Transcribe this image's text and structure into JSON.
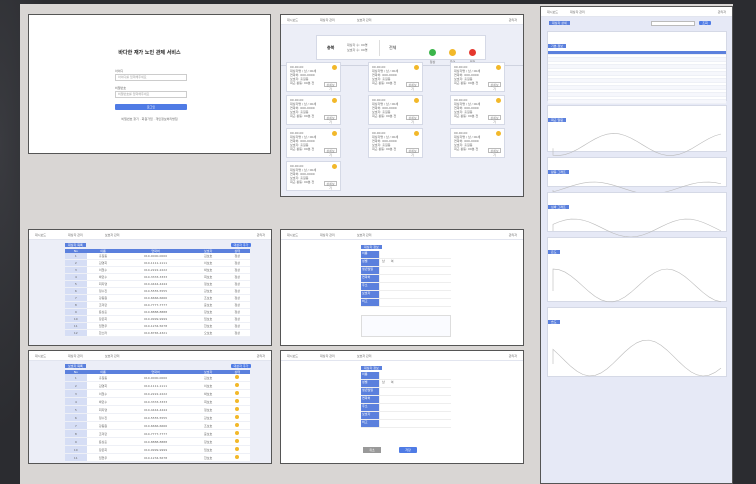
{
  "login": {
    "title": "바다한 재가 노인 관제 서비스",
    "id_label": "아이디",
    "id_placeholder": "아이디를 입력해주세요",
    "pw_label": "비밀번호",
    "pw_placeholder": "비밀번호를 입력해주세요",
    "submit": "로그인",
    "note": "비밀번호 찾기 · 회원가입 · 개인정보처리방침"
  },
  "nav": {
    "tabs": [
      "대시보드",
      "대상자 관리",
      "보호자 관리",
      "사용자 관리"
    ],
    "user": "관리자"
  },
  "dashboard": {
    "location": "충북",
    "count1": "대상자 수: 00명",
    "count2": "보호자 수: 00명",
    "region": "전체",
    "legend": [
      "정상",
      "주의",
      "위험"
    ],
    "card_meta": "00.00.00",
    "card_lines": [
      "대상자명 / 남 / 00세",
      "연락처: 000-0000",
      "보호자: 홍길동",
      "최근 활동: 00분 전"
    ],
    "card_btn": "상세보기"
  },
  "list": {
    "title": "대상자 목록",
    "btn": "대상자 추가",
    "cols": [
      "No",
      "이름",
      "연락처",
      "보호자",
      "상태"
    ],
    "rows": [
      [
        "1",
        "홍길동",
        "010-0000-0000",
        "김보호",
        "정상"
      ],
      [
        "2",
        "김영희",
        "010-1111-1111",
        "이보호",
        "정상"
      ],
      [
        "3",
        "이철수",
        "010-2222-2222",
        "박보호",
        "정상"
      ],
      [
        "4",
        "박민수",
        "010-3333-3333",
        "최보호",
        "정상"
      ],
      [
        "5",
        "최지영",
        "010-4444-4444",
        "정보호",
        "정상"
      ],
      [
        "6",
        "정수진",
        "010-5555-5555",
        "강보호",
        "정상"
      ],
      [
        "7",
        "강동원",
        "010-6666-6666",
        "조보호",
        "정상"
      ],
      [
        "8",
        "조미란",
        "010-7777-7777",
        "윤보호",
        "정상"
      ],
      [
        "9",
        "윤상훈",
        "010-8888-8888",
        "장보호",
        "정상"
      ],
      [
        "10",
        "장은희",
        "010-9999-9999",
        "임보호",
        "정상"
      ],
      [
        "11",
        "임현우",
        "010-1234-5678",
        "한보호",
        "정상"
      ],
      [
        "12",
        "한소라",
        "010-8765-4321",
        "오보호",
        "정상"
      ]
    ]
  },
  "list2": {
    "title": "보호자 목록",
    "rows": 11
  },
  "form": {
    "title": "대상자 정보",
    "labels": [
      "이름",
      "성별",
      "생년월일",
      "연락처",
      "주소",
      "보호자",
      "비고"
    ],
    "gender": [
      "남",
      "여"
    ],
    "cancel": "취소",
    "save": "저장"
  },
  "right": {
    "title": "대상자 상세",
    "sections": [
      "기본 정보",
      "최근 알림",
      "활동 그래프",
      "심박 그래프",
      "온도",
      "습도"
    ],
    "search_btn": "조회",
    "table_rows": 15
  }
}
